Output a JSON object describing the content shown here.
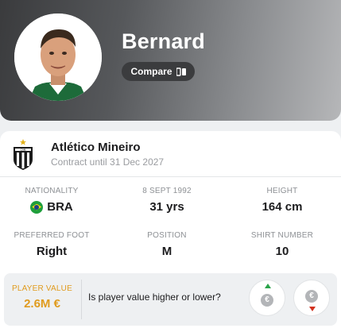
{
  "player": {
    "name": "Bernard",
    "compare_label": "Compare"
  },
  "team": {
    "name": "Atlético Mineiro",
    "contract": "Contract until 31 Dec 2027"
  },
  "stats": {
    "nationality": {
      "label": "NATIONALITY",
      "value": "BRA"
    },
    "age": {
      "label": "8 SEPT 1992",
      "value": "31 yrs"
    },
    "height": {
      "label": "HEIGHT",
      "value": "164 cm"
    },
    "foot": {
      "label": "PREFERRED FOOT",
      "value": "Right"
    },
    "position": {
      "label": "POSITION",
      "value": "M"
    },
    "shirt": {
      "label": "SHIRT NUMBER",
      "value": "10"
    }
  },
  "player_value": {
    "label": "PLAYER VALUE",
    "value": "2.6M €",
    "question": "Is player value higher or lower?"
  },
  "colors": {
    "accent": "#e09b1e",
    "up": "#2aa34a",
    "down": "#d2311f",
    "header_dark": "#3a3b3d"
  },
  "icons": {
    "compare": "compare-icon",
    "team": "atletico-mineiro-crest-icon",
    "nationality": "brazil-flag-icon",
    "higher": "value-higher-icon",
    "lower": "value-lower-icon"
  }
}
